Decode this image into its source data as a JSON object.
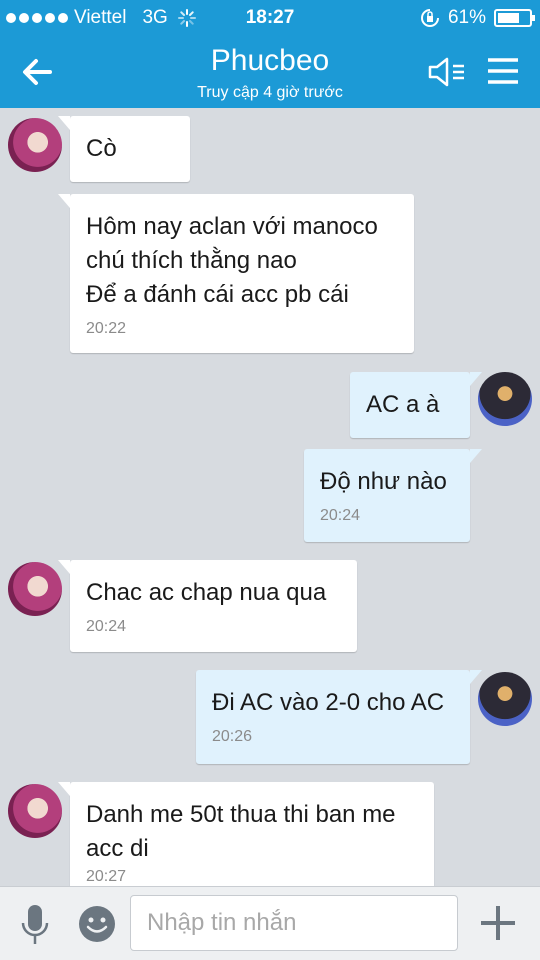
{
  "status_bar": {
    "carrier": "Viettel",
    "network": "3G",
    "time": "18:27",
    "battery": "61%",
    "battery_level": 0.61
  },
  "header": {
    "title": "Phucbeo",
    "subtitle": "Truy cập 4 giờ trước",
    "icons": [
      "back-arrow-icon",
      "speaker-icon",
      "menu-icon"
    ]
  },
  "messages": [
    {
      "sender": "them",
      "text": "Cò",
      "time": ""
    },
    {
      "sender": "them",
      "text": "Hôm nay aclan với manoco\nchú thích thằng nao\nĐể a đánh cái acc pb cái",
      "time": "20:22"
    },
    {
      "sender": "me",
      "text": "AC a à",
      "time": ""
    },
    {
      "sender": "me",
      "text": "Độ như nào",
      "time": "20:24"
    },
    {
      "sender": "them",
      "text": "Chac ac chap nua qua",
      "time": "20:24"
    },
    {
      "sender": "me",
      "text": "Đi AC vào 2-0 cho AC",
      "time": "20:26"
    },
    {
      "sender": "them",
      "text": "Danh me 50t thua thi ban me\nacc di",
      "time": "20:27"
    }
  ],
  "input_bar": {
    "placeholder": "Nhập tin nhắn",
    "value": "",
    "icons": [
      "mic-icon",
      "emoji-icon",
      "plus-icon"
    ]
  },
  "colors": {
    "header": "#1c9ad6",
    "background": "#d7dbe0",
    "incoming": "#ffffff",
    "outgoing": "#e0f2fd",
    "icon": "#6b7680"
  }
}
